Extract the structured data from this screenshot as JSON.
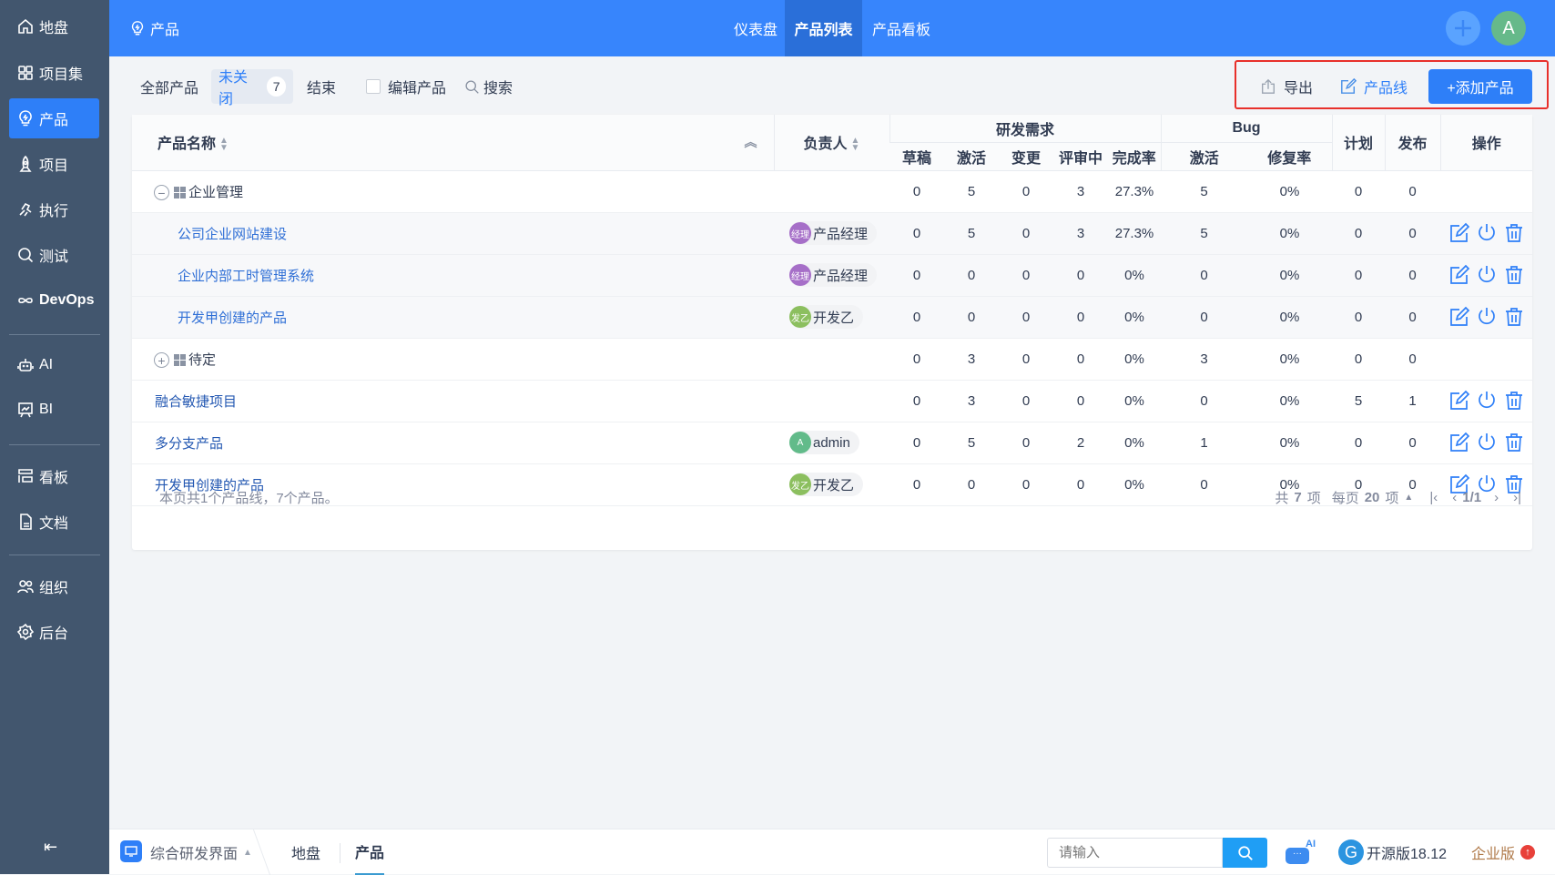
{
  "sidebar": {
    "items": [
      {
        "label": "地盘",
        "icon": "home-icon"
      },
      {
        "label": "项目集",
        "icon": "grid-icon"
      },
      {
        "label": "产品",
        "icon": "lightbulb-icon",
        "active": true
      },
      {
        "label": "项目",
        "icon": "rocket-icon"
      },
      {
        "label": "执行",
        "icon": "run-icon"
      },
      {
        "label": "测试",
        "icon": "test-icon"
      },
      {
        "label": "DevOps",
        "icon": "infinity-icon"
      },
      {
        "label": "AI",
        "icon": "robot-icon"
      },
      {
        "label": "BI",
        "icon": "chart-board-icon"
      },
      {
        "label": "看板",
        "icon": "kanban-icon"
      },
      {
        "label": "文档",
        "icon": "doc-icon"
      },
      {
        "label": "组织",
        "icon": "users-icon"
      },
      {
        "label": "后台",
        "icon": "gear-icon"
      }
    ]
  },
  "topbar": {
    "module": "产品",
    "nav": [
      "仪表盘",
      "产品列表",
      "产品看板"
    ],
    "avatar": "A"
  },
  "toolbar": {
    "tabs": {
      "all": "全部产品",
      "open": "未关闭",
      "open_count": "7",
      "closed": "结束"
    },
    "edit_label": "编辑产品",
    "search_label": "搜索",
    "export_label": "导出",
    "line_label": "产品线",
    "add_label": "+添加产品"
  },
  "table": {
    "headers": {
      "name": "产品名称",
      "owner": "负责人",
      "story_group": "研发需求",
      "draft": "草稿",
      "active": "激活",
      "changed": "变更",
      "reviewing": "评审中",
      "completion": "完成率",
      "bug_group": "Bug",
      "bug_active": "激活",
      "fix_rate": "修复率",
      "plan": "计划",
      "release": "发布",
      "actions": "操作"
    },
    "rows": [
      {
        "type": "group",
        "expanded": true,
        "name": "企业管理",
        "owner": "",
        "vals": [
          "0",
          "5",
          "0",
          "3",
          "27.3%",
          "5",
          "0%",
          "0",
          "0"
        ]
      },
      {
        "type": "child",
        "name": "公司企业网站建设",
        "owner": "产品经理",
        "avatar": "经理",
        "avatar_color": "#a66fc8",
        "vals": [
          "0",
          "5",
          "0",
          "3",
          "27.3%",
          "5",
          "0%",
          "0",
          "0"
        ]
      },
      {
        "type": "child",
        "name": "企业内部工时管理系统",
        "owner": "产品经理",
        "avatar": "经理",
        "avatar_color": "#a66fc8",
        "vals": [
          "0",
          "0",
          "0",
          "0",
          "0%",
          "0",
          "0%",
          "0",
          "0"
        ]
      },
      {
        "type": "child",
        "name": "开发甲创建的产品",
        "owner": "开发乙",
        "avatar": "发乙",
        "avatar_color": "#8cbf5f",
        "vals": [
          "0",
          "0",
          "0",
          "0",
          "0%",
          "0",
          "0%",
          "0",
          "0"
        ]
      },
      {
        "type": "group",
        "expanded": false,
        "name": "待定",
        "owner": "",
        "vals": [
          "0",
          "3",
          "0",
          "0",
          "0%",
          "3",
          "0%",
          "0",
          "0"
        ]
      },
      {
        "type": "product",
        "name": "融合敏捷项目",
        "owner": "",
        "vals": [
          "0",
          "3",
          "0",
          "0",
          "0%",
          "0",
          "0%",
          "5",
          "1"
        ]
      },
      {
        "type": "product",
        "name": "多分支产品",
        "owner": "admin",
        "avatar": "A",
        "avatar_color": "#62bb8a",
        "vals": [
          "0",
          "5",
          "0",
          "2",
          "0%",
          "1",
          "0%",
          "0",
          "0"
        ]
      },
      {
        "type": "product",
        "name": "开发甲创建的产品",
        "owner": "开发乙",
        "avatar": "发乙",
        "avatar_color": "#8cbf5f",
        "vals": [
          "0",
          "0",
          "0",
          "0",
          "0%",
          "0",
          "0%",
          "0",
          "0"
        ]
      }
    ],
    "summary": "本页共1个产品线，7个产品。",
    "pager": {
      "total_pre": "共",
      "total": "7",
      "total_post": "项",
      "per_pre": "每页",
      "per": "20",
      "per_post": "项",
      "page": "1/1"
    }
  },
  "bottombar": {
    "workspace": "综合研发界面",
    "crumbs": [
      "地盘",
      "产品"
    ],
    "search_placeholder": "请输入",
    "ai_badge": "AI",
    "version": "开源版18.12",
    "enterprise": "企业版"
  },
  "colors": {
    "primary": "#2e7ff8",
    "topbar": "#3785fc",
    "sidebar": "#42566e",
    "highlight_box": "#e8302b"
  }
}
